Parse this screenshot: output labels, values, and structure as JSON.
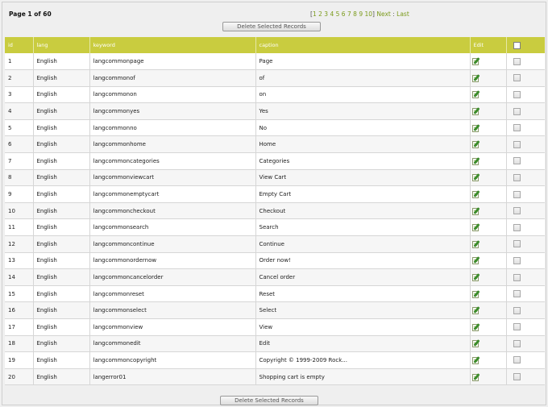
{
  "header": {
    "page_info": "Page 1 of 60",
    "pager_open": "[",
    "pages": [
      "1",
      "2",
      "3",
      "4",
      "5",
      "6",
      "7",
      "8",
      "9",
      "10"
    ],
    "pager_close": "]",
    "next": "Next",
    "separator": ":",
    "last": "Last"
  },
  "buttons": {
    "delete_top": "Delete Selected Records",
    "delete_bottom": "Delete Selected Records"
  },
  "table": {
    "columns": [
      "id",
      "lang",
      "keyword",
      "caption",
      "Edit"
    ],
    "rows": [
      {
        "id": "1",
        "lang": "English",
        "keyword": "langcommonpage",
        "caption": "Page"
      },
      {
        "id": "2",
        "lang": "English",
        "keyword": "langcommonof",
        "caption": "of"
      },
      {
        "id": "3",
        "lang": "English",
        "keyword": "langcommonon",
        "caption": "on"
      },
      {
        "id": "4",
        "lang": "English",
        "keyword": "langcommonyes",
        "caption": "Yes"
      },
      {
        "id": "5",
        "lang": "English",
        "keyword": "langcommonno",
        "caption": "No"
      },
      {
        "id": "6",
        "lang": "English",
        "keyword": "langcommonhome",
        "caption": "Home"
      },
      {
        "id": "7",
        "lang": "English",
        "keyword": "langcommoncategories",
        "caption": "Categories"
      },
      {
        "id": "8",
        "lang": "English",
        "keyword": "langcommonviewcart",
        "caption": "View Cart"
      },
      {
        "id": "9",
        "lang": "English",
        "keyword": "langcommonemptycart",
        "caption": "Empty Cart"
      },
      {
        "id": "10",
        "lang": "English",
        "keyword": "langcommoncheckout",
        "caption": "Checkout"
      },
      {
        "id": "11",
        "lang": "English",
        "keyword": "langcommonsearch",
        "caption": "Search"
      },
      {
        "id": "12",
        "lang": "English",
        "keyword": "langcommoncontinue",
        "caption": "Continue"
      },
      {
        "id": "13",
        "lang": "English",
        "keyword": "langcommonordernow",
        "caption": "Order now!"
      },
      {
        "id": "14",
        "lang": "English",
        "keyword": "langcommoncancelorder",
        "caption": "Cancel order"
      },
      {
        "id": "15",
        "lang": "English",
        "keyword": "langcommonreset",
        "caption": "Reset"
      },
      {
        "id": "16",
        "lang": "English",
        "keyword": "langcommonselect",
        "caption": "Select"
      },
      {
        "id": "17",
        "lang": "English",
        "keyword": "langcommonview",
        "caption": "View"
      },
      {
        "id": "18",
        "lang": "English",
        "keyword": "langcommonedit",
        "caption": "Edit"
      },
      {
        "id": "19",
        "lang": "English",
        "keyword": "langcommoncopyright",
        "caption": "Copyright © 1999-2009 Rock..."
      },
      {
        "id": "20",
        "lang": "English",
        "keyword": "langerror01",
        "caption": "Shopping cart is empty"
      }
    ]
  },
  "colors": {
    "header_bg": "#c9cc3f",
    "link": "#7a9a1a"
  },
  "icons": {
    "edit": "edit-icon",
    "checkbox": "checkbox-icon"
  }
}
